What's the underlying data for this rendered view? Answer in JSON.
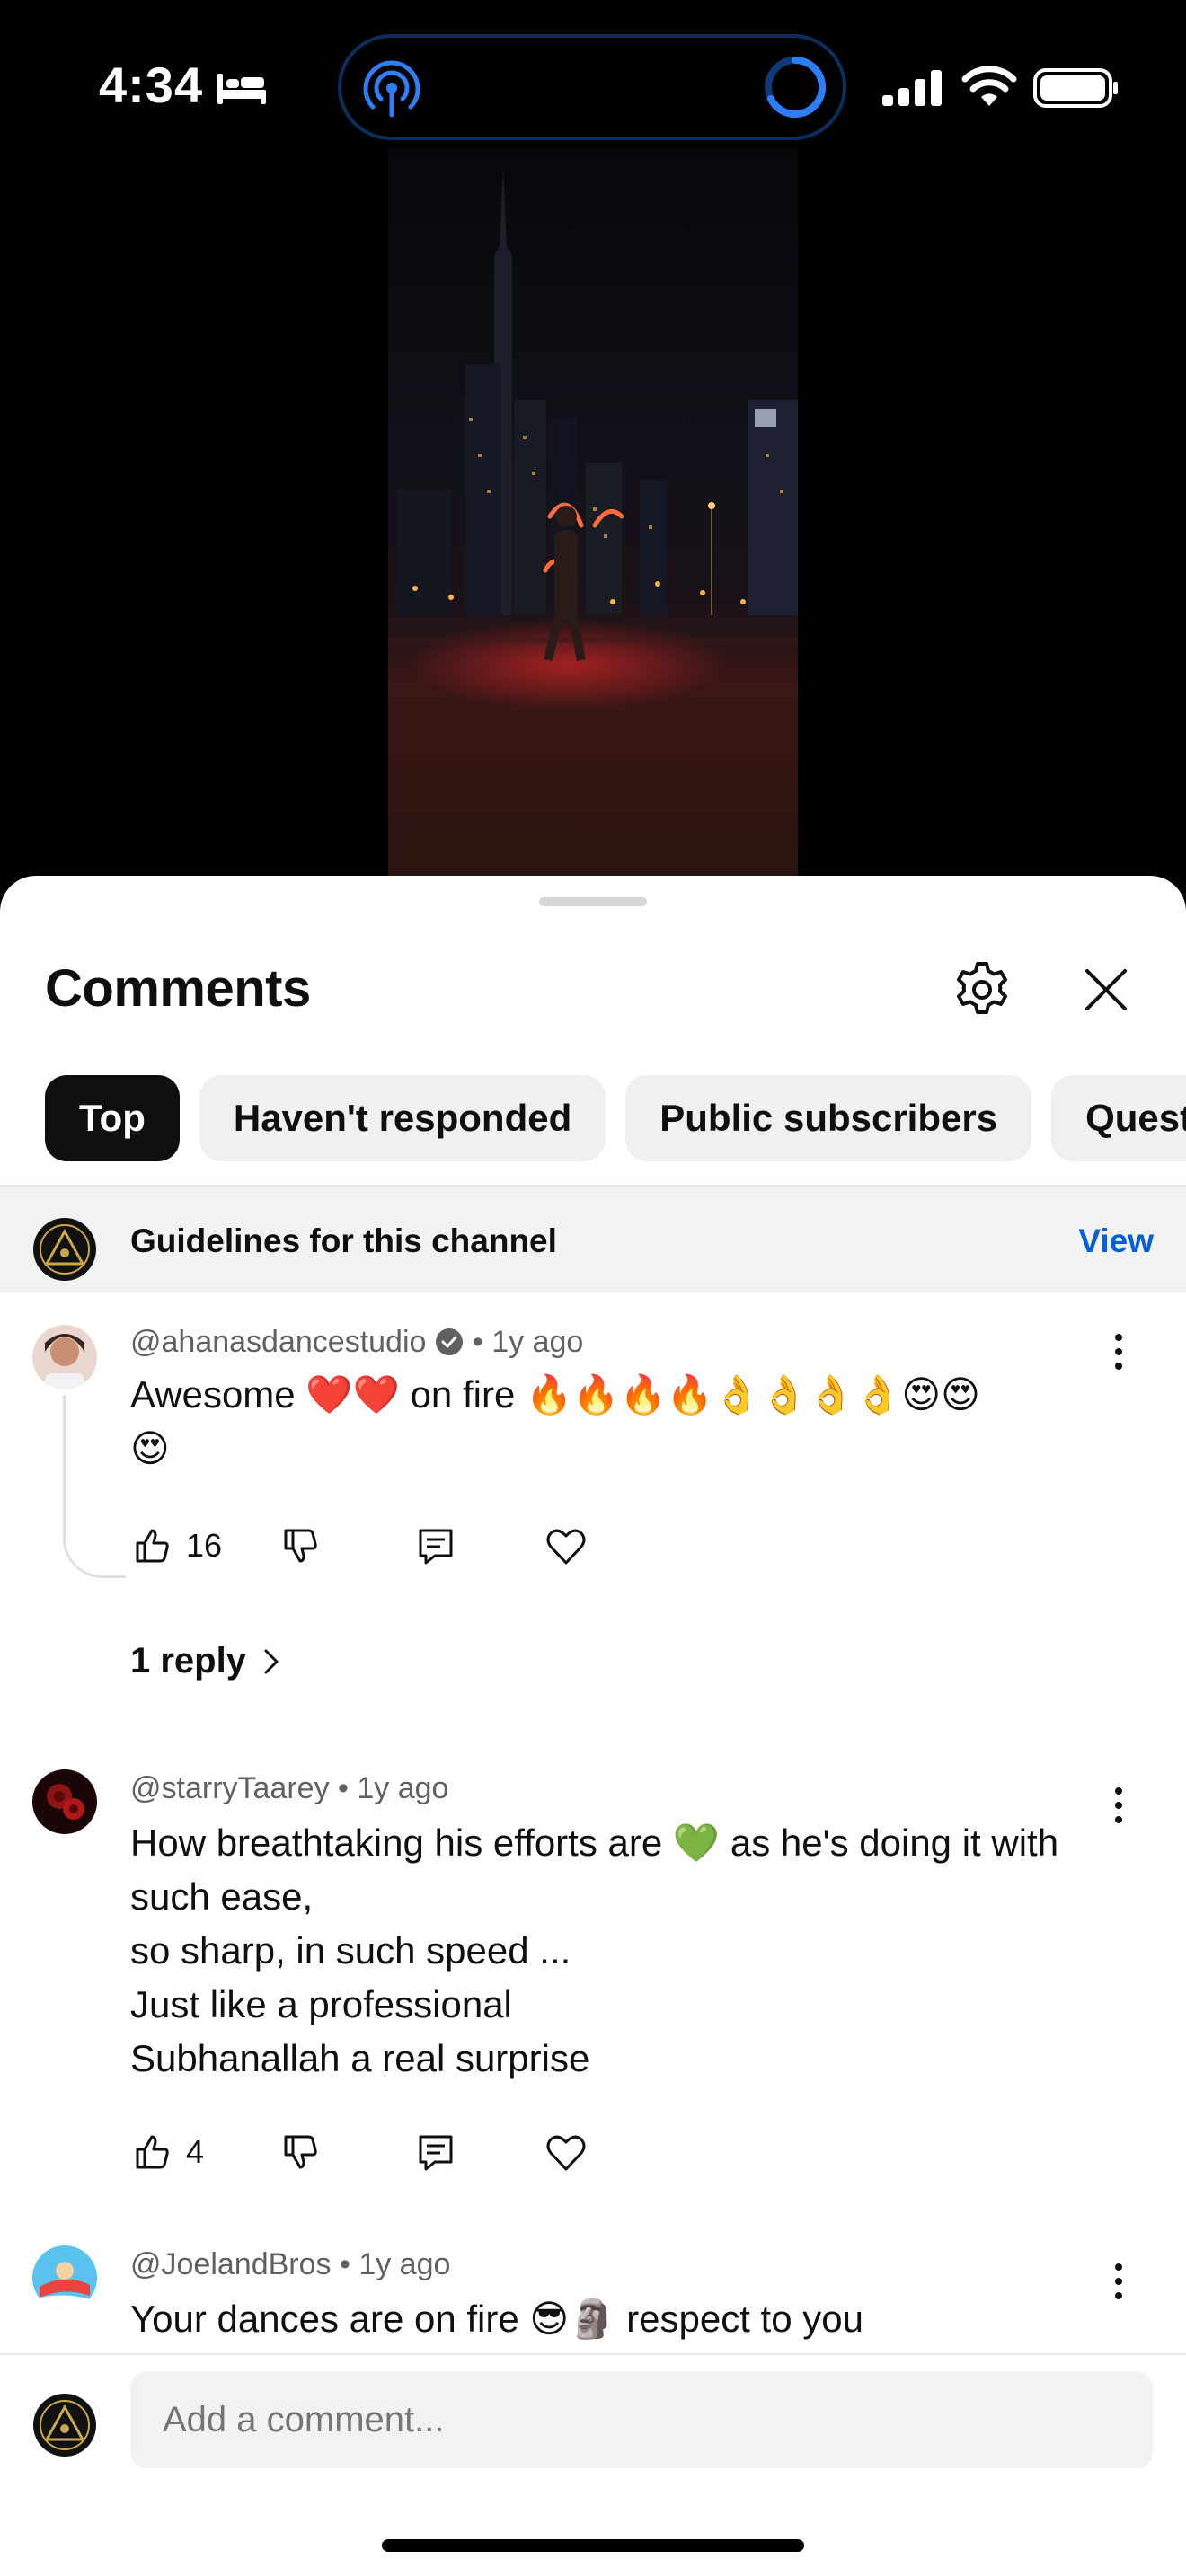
{
  "status": {
    "time": "4:34"
  },
  "sheet": {
    "title": "Comments"
  },
  "chips": [
    {
      "label": "Top"
    },
    {
      "label": "Haven't responded"
    },
    {
      "label": "Public subscribers"
    },
    {
      "label": "Questions"
    }
  ],
  "guidelines": {
    "text": "Guidelines for this channel",
    "action": "View"
  },
  "comments": [
    {
      "author": "@ahanasdancestudio",
      "verified": true,
      "age": "1y ago",
      "lines": [
        "Awesome ❤️❤️ on fire 🔥🔥🔥🔥👌👌👌👌😍😍",
        "😍"
      ],
      "likes": "16",
      "replies": "1 reply"
    },
    {
      "author": "@starryTaarey",
      "age": "1y ago",
      "lines": [
        "How breathtaking his efforts are 💚 as he's doing it with",
        "such ease,",
        "so sharp, in such speed ...",
        "Just like a professional",
        "Subhanallah  a real surprise"
      ],
      "likes": "4"
    },
    {
      "author": "@JoelandBros",
      "age": "1y ago",
      "lines": [
        "Your dances are on fire 😎🗿 respect to you"
      ]
    }
  ],
  "composer": {
    "placeholder": "Add a comment..."
  },
  "colors": {
    "accent_link": "#065fd4",
    "chip_active": "#0f0f0f",
    "chip_idle": "#f0f0f0"
  }
}
